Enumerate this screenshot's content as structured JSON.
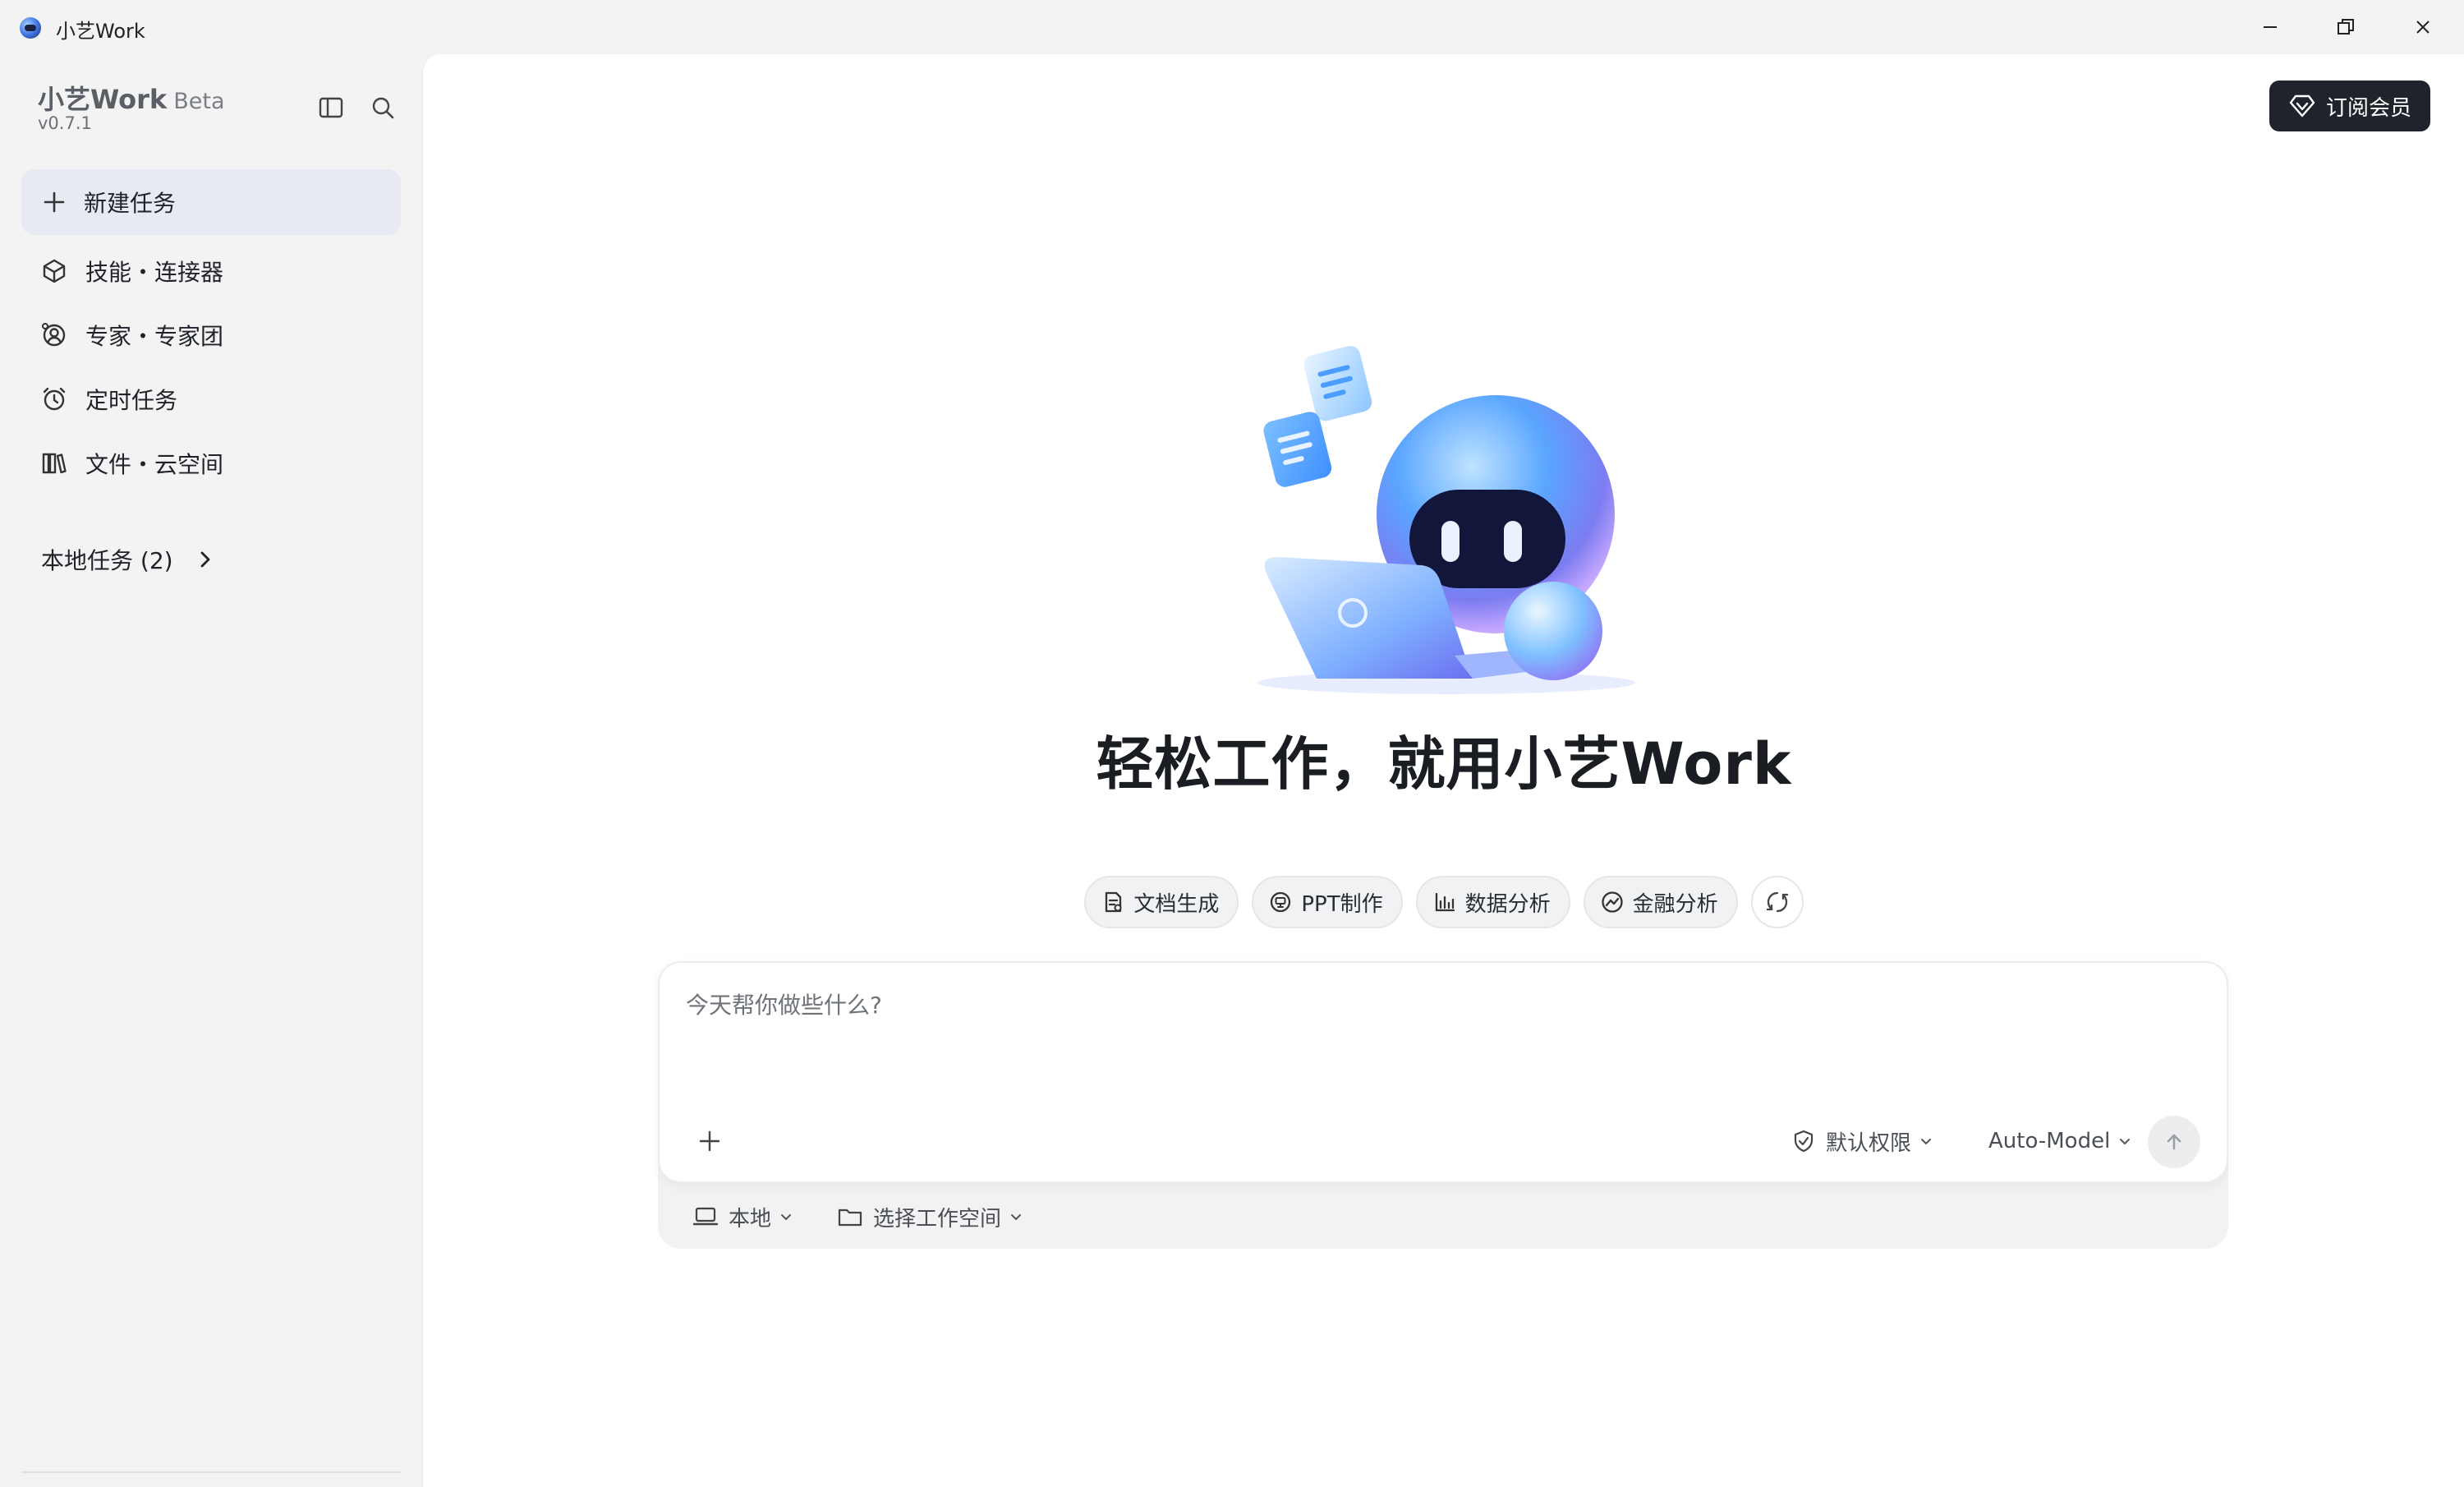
{
  "window": {
    "title": "小艺Work",
    "icons": [
      "app-icon",
      "minimize-icon",
      "maximize-icon",
      "close-icon"
    ]
  },
  "sidebar": {
    "brand_name": "小艺Work",
    "brand_tag": "Beta",
    "version": "v0.7.1",
    "icons": [
      "sidebar-toggle-icon",
      "search-icon"
    ],
    "new_task": {
      "label": "新建任务",
      "icon": "plus-icon"
    },
    "items": [
      {
        "label": "技能・连接器",
        "icon": "cube-icon"
      },
      {
        "label": "专家・专家团",
        "icon": "expert-icon"
      },
      {
        "label": "定时任务",
        "icon": "alarm-clock-icon"
      },
      {
        "label": "文件・云空间",
        "icon": "books-icon"
      }
    ],
    "local_tasks": {
      "label": "本地任务 (2)",
      "icon": "chevron-right-icon"
    }
  },
  "main": {
    "subscribe_label": "订阅会员",
    "subscribe_icon": "diamond-icon",
    "headline": "轻松工作，就用小艺Work",
    "chips": [
      {
        "label": "文档生成",
        "icon": "document-icon"
      },
      {
        "label": "PPT制作",
        "icon": "presentation-icon"
      },
      {
        "label": "数据分析",
        "icon": "bar-chart-icon"
      },
      {
        "label": "金融分析",
        "icon": "trend-icon"
      }
    ],
    "refresh_icon": "refresh-icon",
    "composer": {
      "placeholder": "今天帮你做些什么?",
      "permission_label": "默认权限",
      "model_label": "Auto-Model",
      "local_label": "本地",
      "workspace_label": "选择工作空间"
    }
  },
  "colors": {
    "accent_dark": "#1f242c",
    "sidebar_bg": "#f3f3f3",
    "main_bg": "#ffffff",
    "new_task_bg": "#e7eaf3"
  }
}
